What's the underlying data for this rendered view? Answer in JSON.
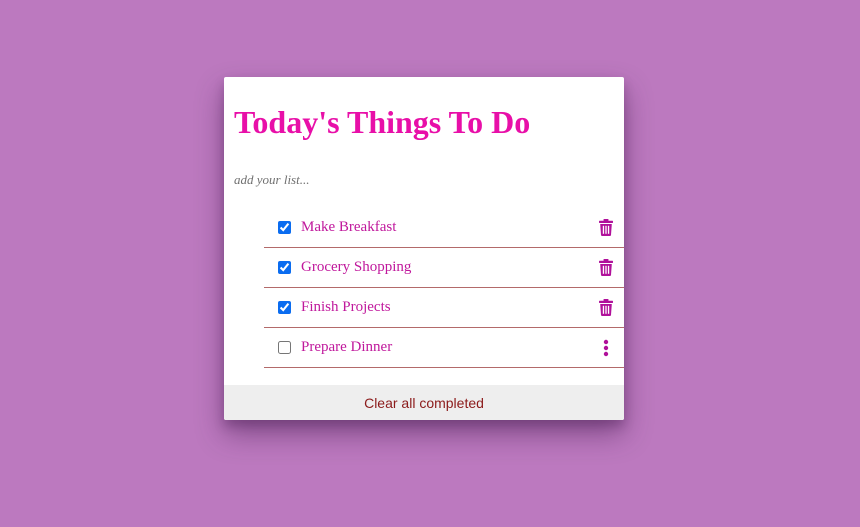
{
  "app": {
    "title": "Today's Things To Do",
    "input_placeholder": "add your list..."
  },
  "todos": [
    {
      "label": "Make Breakfast",
      "completed": true,
      "action_icon": "trash-icon"
    },
    {
      "label": "Grocery Shopping",
      "completed": true,
      "action_icon": "trash-icon"
    },
    {
      "label": "Finish Projects",
      "completed": true,
      "action_icon": "trash-icon"
    },
    {
      "label": "Prepare Dinner",
      "completed": false,
      "action_icon": "more-vertical-icon"
    }
  ],
  "footer": {
    "clear_label": "Clear all completed"
  },
  "colors": {
    "background": "#bc79bf",
    "title": "#e80fa8",
    "item_text": "#c0189c",
    "icon": "#b0109a",
    "divider": "#b36a6a",
    "footer_text": "#8b1a1a"
  }
}
